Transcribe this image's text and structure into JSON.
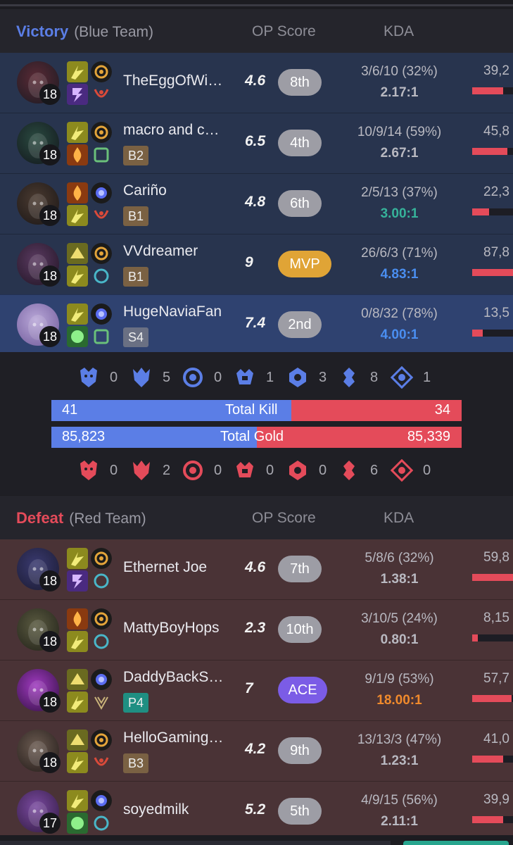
{
  "blue_team": {
    "result": "Victory",
    "team_name": "(Blue Team)",
    "col_op": "OP Score",
    "col_kda": "KDA",
    "accent": "#5b7ee6",
    "players": [
      {
        "name": "TheEggOfWi…",
        "level": "18",
        "tag": "",
        "op_score": "4.6",
        "rank": "8th",
        "kda": "3/6/10 (32%)",
        "ratio": "2.17:1",
        "ratio_color": "#b9b9c1",
        "damage": "39,2",
        "dmg_fraction": 0.75
      },
      {
        "name": "macro and c…",
        "level": "18",
        "tag": "B2",
        "op_score": "6.5",
        "rank": "4th",
        "kda": "10/9/14 (59%)",
        "ratio": "2.67:1",
        "ratio_color": "#b9b9c1",
        "damage": "45,8",
        "dmg_fraction": 0.87
      },
      {
        "name": "Cariño",
        "level": "18",
        "tag": "B1",
        "op_score": "4.8",
        "rank": "6th",
        "kda": "2/5/13 (37%)",
        "ratio": "3.00:1",
        "ratio_color": "#36b39a",
        "damage": "22,3",
        "dmg_fraction": 0.42
      },
      {
        "name": "VVdreamer",
        "level": "18",
        "tag": "B1",
        "op_score": "9",
        "rank": "MVP",
        "kda": "26/6/3 (71%)",
        "ratio": "4.83:1",
        "ratio_color": "#4a8ef0",
        "damage": "87,8",
        "dmg_fraction": 1.0
      },
      {
        "name": "HugeNaviaFan",
        "level": "18",
        "tag": "S4",
        "op_score": "7.4",
        "rank": "2nd",
        "kda": "0/8/32 (78%)",
        "ratio": "4.00:1",
        "ratio_color": "#4a8ef0",
        "damage": "13,5",
        "dmg_fraction": 0.26
      }
    ]
  },
  "summary": {
    "blue_objectives": [
      "0",
      "5",
      "0",
      "1",
      "3",
      "8",
      "1"
    ],
    "red_objectives": [
      "0",
      "2",
      "0",
      "0",
      "0",
      "6",
      "0"
    ],
    "total_kill": {
      "label": "Total Kill",
      "blue": "41",
      "red": "34"
    },
    "total_gold": {
      "label": "Total Gold",
      "blue": "85,823",
      "red": "85,339"
    }
  },
  "red_team": {
    "result": "Defeat",
    "team_name": "(Red Team)",
    "col_op": "OP Score",
    "col_kda": "KDA",
    "accent": "#e44b5a",
    "players": [
      {
        "name": "Ethernet Joe",
        "level": "18",
        "tag": "",
        "op_score": "4.6",
        "rank": "7th",
        "kda": "5/8/6 (32%)",
        "ratio": "1.38:1",
        "ratio_color": "#b9b9c1",
        "damage": "59,8",
        "dmg_fraction": 1.0
      },
      {
        "name": "MattyBoyHops",
        "level": "18",
        "tag": "",
        "op_score": "2.3",
        "rank": "10th",
        "kda": "3/10/5 (24%)",
        "ratio": "0.80:1",
        "ratio_color": "#b9b9c1",
        "damage": "8,15",
        "dmg_fraction": 0.14
      },
      {
        "name": "DaddyBackS…",
        "level": "18",
        "tag": "P4",
        "op_score": "7",
        "rank": "ACE",
        "kda": "9/1/9 (53%)",
        "ratio": "18.00:1",
        "ratio_color": "#f08a2c",
        "damage": "57,7",
        "dmg_fraction": 0.97
      },
      {
        "name": "HelloGaming…",
        "level": "18",
        "tag": "B3",
        "op_score": "4.2",
        "rank": "9th",
        "kda": "13/13/3 (47%)",
        "ratio": "1.23:1",
        "ratio_color": "#b9b9c1",
        "damage": "41,0",
        "dmg_fraction": 0.76
      },
      {
        "name": "soyedmilk",
        "level": "17",
        "tag": "",
        "op_score": "5.2",
        "rank": "5th",
        "kda": "4/9/15 (56%)",
        "ratio": "2.11:1",
        "ratio_color": "#b9b9c1",
        "damage": "39,9",
        "dmg_fraction": 0.75
      }
    ]
  }
}
